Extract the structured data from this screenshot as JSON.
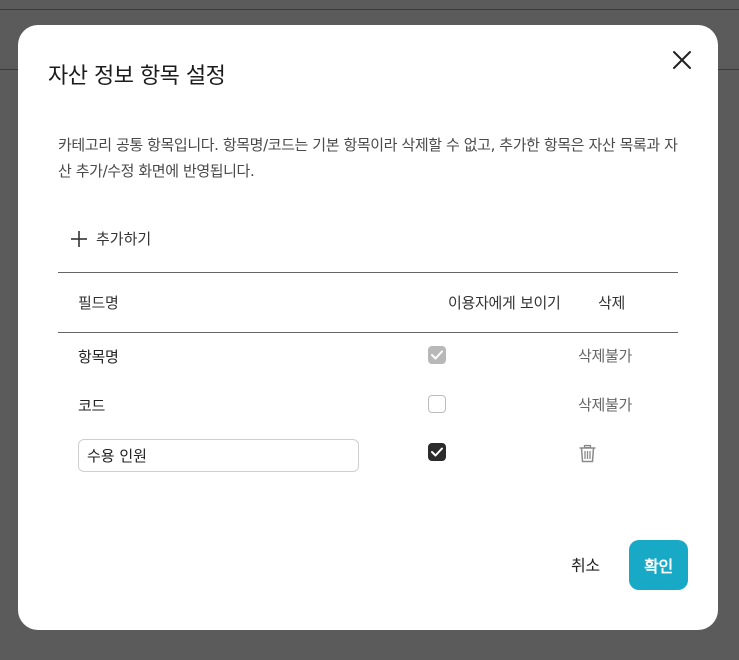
{
  "dialog": {
    "title": "자산 정보 항목 설정",
    "description": "카테고리 공통 항목입니다. 항목명/코드는 기본 항목이라 삭제할 수 없고, 추가한 항목은 자산 목록과 자산 추가/수정 화면에 반영됩니다.",
    "add_label": "추가하기",
    "columns": {
      "field_name": "필드명",
      "visible_to_user": "이용자에게 보이기",
      "delete": "삭제"
    },
    "rows": [
      {
        "name": "항목명",
        "visible": "checked-disabled",
        "delete_text": "삭제불가"
      },
      {
        "name": "코드",
        "visible": "unchecked",
        "delete_text": "삭제불가"
      },
      {
        "name": "수용 인원",
        "visible": "checked",
        "delete_text": ""
      }
    ],
    "cancel_label": "취소",
    "confirm_label": "확인"
  },
  "colors": {
    "accent": "#17a9c6",
    "backdrop": "#5b5b5b",
    "checkbox_checked": "#2b2b2b",
    "checkbox_disabled": "#b8b8b8"
  },
  "icons": {
    "close": "close-icon",
    "add": "plus-icon",
    "check": "check-icon",
    "delete": "trash-icon"
  }
}
